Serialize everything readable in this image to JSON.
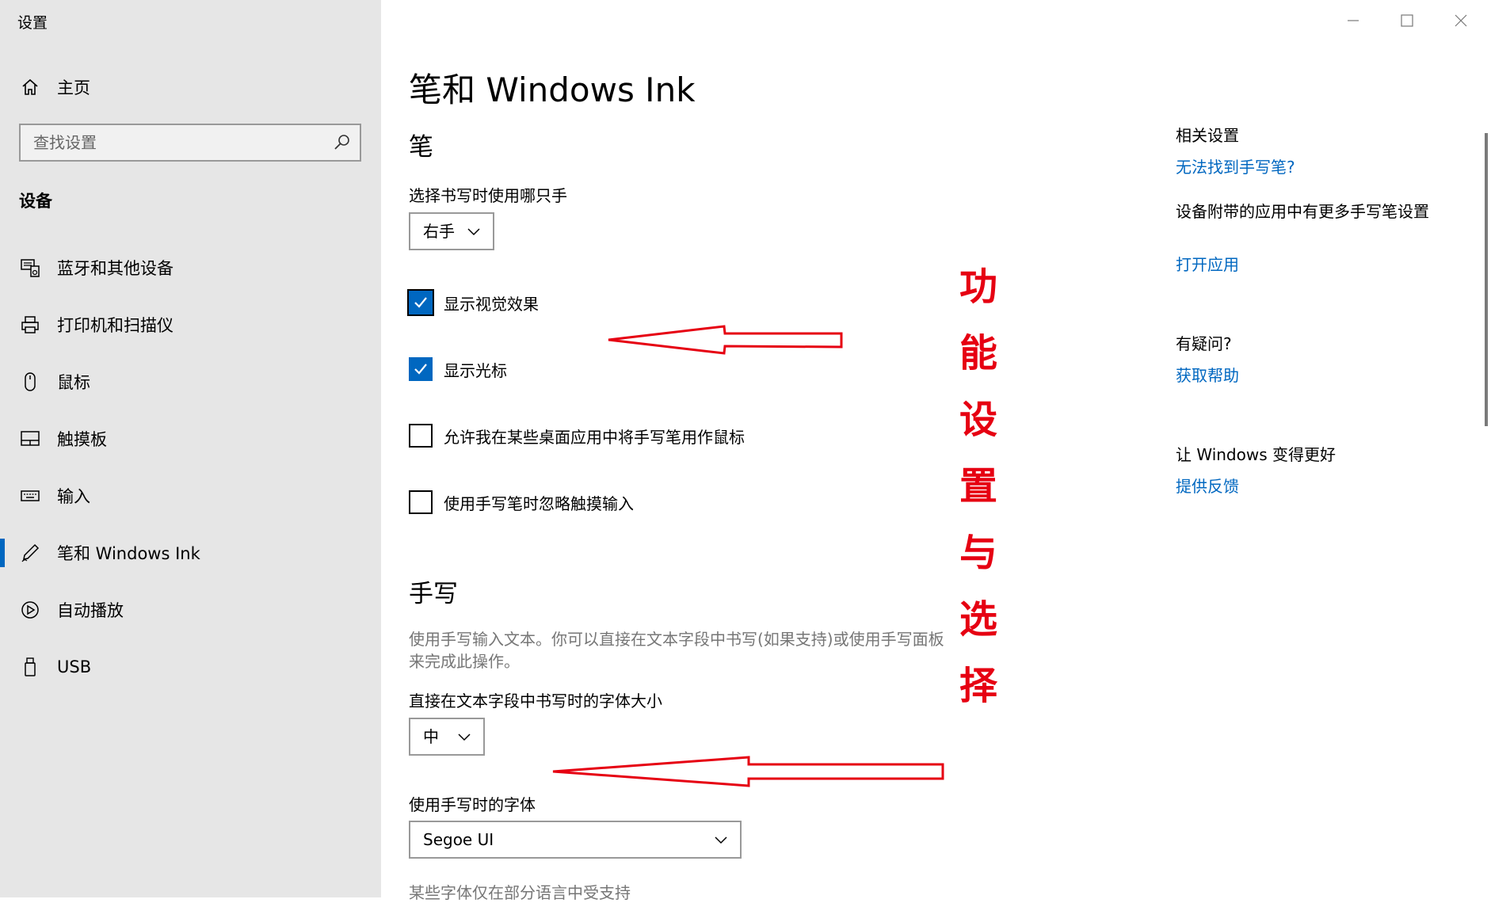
{
  "window": {
    "title": "设置"
  },
  "sidebar": {
    "home": "主页",
    "search_placeholder": "查找设置",
    "group": "设备",
    "items": [
      {
        "label": "蓝牙和其他设备",
        "icon": "bluetooth-devices-icon"
      },
      {
        "label": "打印机和扫描仪",
        "icon": "printer-icon"
      },
      {
        "label": "鼠标",
        "icon": "mouse-icon"
      },
      {
        "label": "触摸板",
        "icon": "touchpad-icon"
      },
      {
        "label": "输入",
        "icon": "keyboard-icon"
      },
      {
        "label": "笔和 Windows Ink",
        "icon": "pen-icon",
        "active": true
      },
      {
        "label": "自动播放",
        "icon": "autoplay-icon"
      },
      {
        "label": "USB",
        "icon": "usb-icon"
      }
    ]
  },
  "main": {
    "title": "笔和 Windows Ink",
    "pen": {
      "heading": "笔",
      "hand_label": "选择书写时使用哪只手",
      "hand_value": "右手",
      "checkboxes": [
        {
          "label": "显示视觉效果",
          "checked": true
        },
        {
          "label": "显示光标",
          "checked": true
        },
        {
          "label": "允许我在某些桌面应用中将手写笔用作鼠标",
          "checked": false
        },
        {
          "label": "使用手写笔时忽略触摸输入",
          "checked": false
        }
      ]
    },
    "handwriting": {
      "heading": "手写",
      "description": "使用手写输入文本。你可以直接在文本字段中书写(如果支持)或使用手写面板来完成此操作。",
      "font_size_label": "直接在文本字段中书写时的字体大小",
      "font_size_value": "中",
      "font_label": "使用手写时的字体",
      "font_value": "Segoe UI",
      "font_note": "某些字体仅在部分语言中受支持"
    }
  },
  "related": {
    "heading": "相关设置",
    "link1": "无法找到手写笔?",
    "text2": "设备附带的应用中有更多手写笔设置",
    "link2": "打开应用",
    "question_heading": "有疑问?",
    "help_link": "获取帮助",
    "improve_heading": "让 Windows 变得更好",
    "feedback_link": "提供反馈"
  },
  "annotation": {
    "text": "功能设置与选择",
    "color": "#e60012"
  },
  "colors": {
    "accent": "#0067c0",
    "sidebar_bg": "#e6e6e6"
  }
}
